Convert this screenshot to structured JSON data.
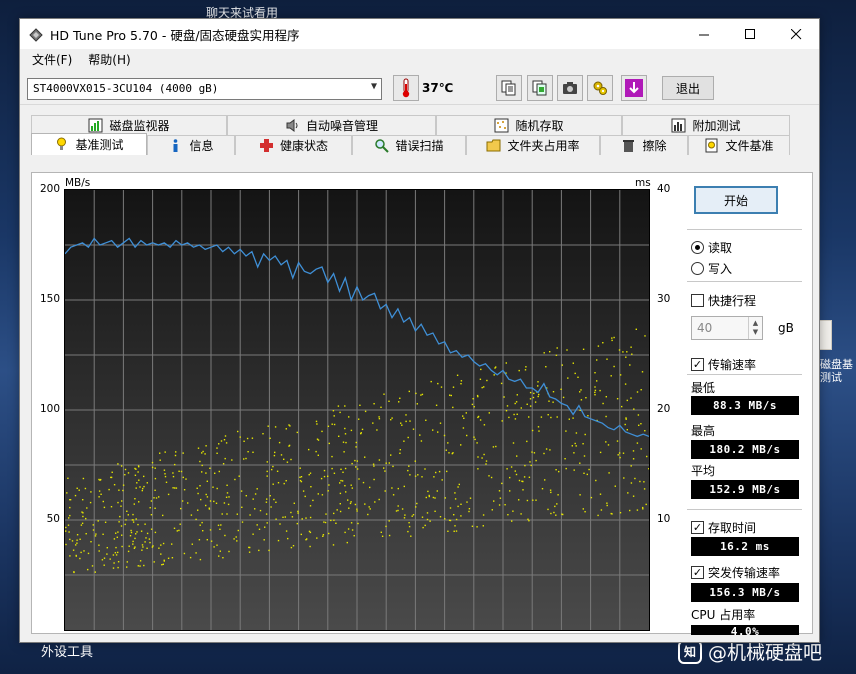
{
  "desktop": {
    "top_text": "聊天来试看用",
    "right_icon_label": "磁盘基\n测试",
    "bottom_label": "外设工具",
    "watermark": "@机械硬盘吧"
  },
  "window": {
    "title": "HD Tune Pro 5.70 - 硬盘/固态硬盘实用程序"
  },
  "menu": {
    "file": "文件(F)",
    "help": "帮助(H)"
  },
  "toolbar": {
    "drive": "ST4000VX015-3CU104 (4000 gB)",
    "temperature": "37℃",
    "exit": "退出"
  },
  "tabs_top": [
    {
      "label": "磁盘监视器",
      "icon": "bar-chart-icon"
    },
    {
      "label": "自动噪音管理",
      "icon": "speaker-icon"
    },
    {
      "label": "随机存取",
      "icon": "random-access-icon"
    },
    {
      "label": "附加测试",
      "icon": "extra-tests-icon"
    }
  ],
  "tabs_bottom": [
    {
      "label": "基准测试",
      "icon": "benchmark-icon",
      "active": true
    },
    {
      "label": "信息",
      "icon": "info-icon"
    },
    {
      "label": "健康状态",
      "icon": "health-cross-icon"
    },
    {
      "label": "错误扫描",
      "icon": "magnifier-icon"
    },
    {
      "label": "文件夹占用率",
      "icon": "folder-icon"
    },
    {
      "label": "擦除",
      "icon": "trash-icon"
    },
    {
      "label": "文件基准",
      "icon": "file-benchmark-icon"
    }
  ],
  "panel": {
    "start": "开始",
    "read": "读取",
    "write": "写入",
    "short_stroke": "快捷行程",
    "short_stroke_value": "40",
    "short_stroke_unit": "gB",
    "transfer_rate": "传输速率",
    "min_label": "最低",
    "min_value": "88.3 MB/s",
    "max_label": "最高",
    "max_value": "180.2 MB/s",
    "avg_label": "平均",
    "avg_value": "152.9 MB/s",
    "access_time": "存取时间",
    "access_value": "16.2 ms",
    "burst_rate": "突发传输速率",
    "burst_value": "156.3 MB/s",
    "cpu_label": "CPU 占用率",
    "cpu_value": "4.0%"
  },
  "chart_data": {
    "type": "line",
    "y_left_label": "MB/s",
    "y_right_label": "ms",
    "y_left_ticks": [
      "200",
      "150",
      "100",
      "50"
    ],
    "y_right_ticks": [
      "40",
      "30",
      "20",
      "10"
    ],
    "ylim_left": [
      0,
      200
    ],
    "ylim_right": [
      0,
      40
    ],
    "grid": true,
    "colors": {
      "transfer": "#3f8fd6",
      "access": "#e6e600",
      "background": "#2a2a2a",
      "grid": "#7a7a7a"
    },
    "series": [
      {
        "name": "传输速率",
        "axis": "left",
        "x": [
          0,
          1,
          2,
          3,
          4,
          5,
          6,
          7,
          8,
          9,
          10,
          11,
          12,
          13,
          14,
          15,
          16,
          17,
          18,
          19,
          20,
          21,
          22,
          23,
          24,
          25,
          26,
          27,
          28,
          29,
          30,
          31,
          32,
          33,
          34,
          35,
          36,
          37,
          38,
          39,
          40,
          41,
          42,
          43,
          44,
          45,
          46,
          47,
          48,
          49,
          50,
          51,
          52,
          53,
          54,
          55,
          56,
          57,
          58,
          59,
          60,
          61,
          62,
          63,
          64,
          65,
          66,
          67,
          68,
          69,
          70,
          71,
          72,
          73,
          74,
          75,
          76,
          77,
          78,
          79,
          80,
          81,
          82,
          83,
          84,
          85,
          86,
          87,
          88,
          89,
          90,
          91,
          92,
          93,
          94,
          95,
          96,
          97,
          98,
          99,
          100
        ],
        "values": [
          171,
          174,
          175,
          176,
          174,
          178,
          175,
          176,
          177,
          174,
          176,
          178,
          174,
          177,
          175,
          176,
          175,
          176,
          174,
          177,
          175,
          176,
          174,
          175,
          173,
          174,
          175,
          172,
          174,
          171,
          173,
          170,
          172,
          165,
          171,
          168,
          170,
          166,
          168,
          160,
          167,
          163,
          162,
          164,
          165,
          158,
          162,
          154,
          160,
          150,
          156,
          150,
          152,
          153,
          146,
          148,
          142,
          146,
          140,
          142,
          136,
          139,
          134,
          135,
          130,
          131,
          126,
          127,
          124,
          125,
          122,
          120,
          121,
          118,
          116,
          118,
          114,
          113,
          114,
          110,
          110,
          108,
          112,
          106,
          105,
          103,
          102,
          98,
          102,
          97,
          96,
          95,
          94,
          92,
          91,
          93,
          90,
          89,
          88,
          89,
          88
        ]
      },
      {
        "name": "存取时间",
        "axis": "right",
        "type": "scatter",
        "note_range_ms": [
          5,
          30
        ],
        "average_ms": 16.2
      }
    ]
  }
}
